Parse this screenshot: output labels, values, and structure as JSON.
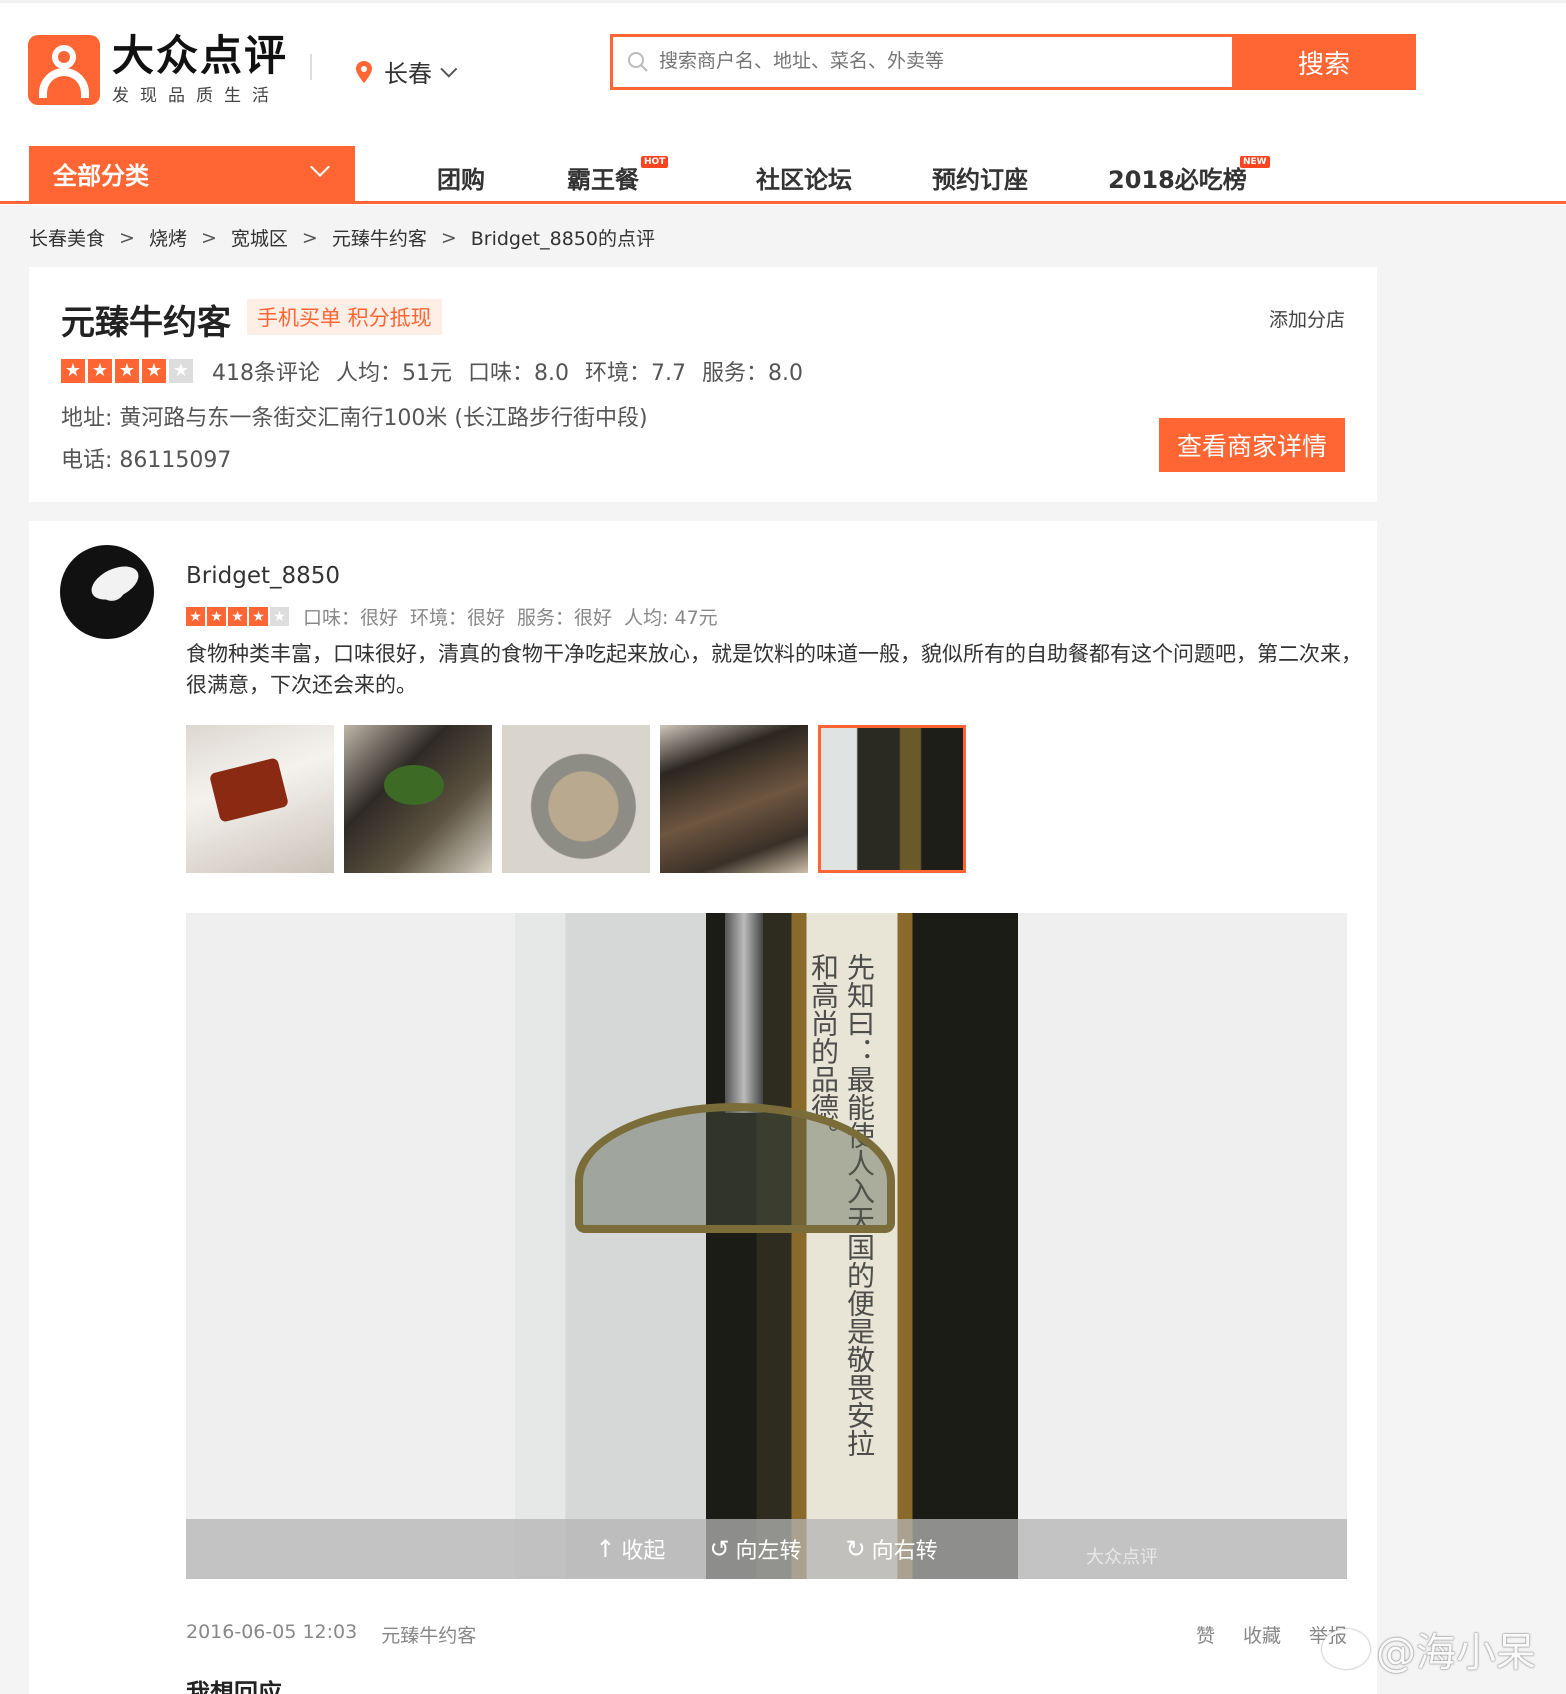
{
  "header": {
    "logo_title": "大众点评",
    "logo_sub": "发现品质生活",
    "city": "长春",
    "search_placeholder": "搜索商户名、地址、菜名、外卖等",
    "search_button": "搜索"
  },
  "nav": {
    "all_categories": "全部分类",
    "items": [
      {
        "label": "团购",
        "badge": ""
      },
      {
        "label": "霸王餐",
        "badge": "HOT"
      },
      {
        "label": "社区论坛",
        "badge": ""
      },
      {
        "label": "预约订座",
        "badge": ""
      },
      {
        "label": "2018必吃榜",
        "badge": "NEW"
      }
    ]
  },
  "breadcrumb": [
    "长春美食",
    "烧烤",
    "宽城区",
    "元臻牛约客",
    "Bridget_8850的点评"
  ],
  "shop": {
    "name": "元臻牛约客",
    "tag": "手机买单 积分抵现",
    "add_branch": "添加分店",
    "rating_stars": 4,
    "reviews": "418条评论",
    "avg_price": "人均：51元",
    "taste": "口味：8.0",
    "environment": "环境：7.7",
    "service": "服务：8.0",
    "address": "地址: 黄河路与东一条街交汇南行100米 (长江路步行街中段)",
    "phone": "电话: 86115097",
    "detail_button": "查看商家详情"
  },
  "review": {
    "user": "Bridget_8850",
    "rating_stars": 4,
    "taste": "口味：很好",
    "environment": "环境：很好",
    "service": "服务：很好",
    "avg_price": "人均: 47元",
    "text": "食物种类丰富，口味很好，清真的食物干净吃起来放心，就是饮料的味道一般，貌似所有的自助餐都有这个问题吧，第二次来，很满意，下次还会来的。",
    "viewer": {
      "collapse": "收起",
      "rotate_left": "向左转",
      "rotate_right": "向右转",
      "watermark": "大众点评",
      "frame_text": "先知曰：最能使人入天国的便是敬畏安拉和高尚的品德。"
    },
    "date": "2016-06-05 12:03",
    "shop_ref": "元臻牛约客",
    "actions": {
      "like": "赞",
      "favorite": "收藏",
      "report": "举报"
    },
    "reply_title": "我想回应"
  },
  "watermark": "@海小呆"
}
